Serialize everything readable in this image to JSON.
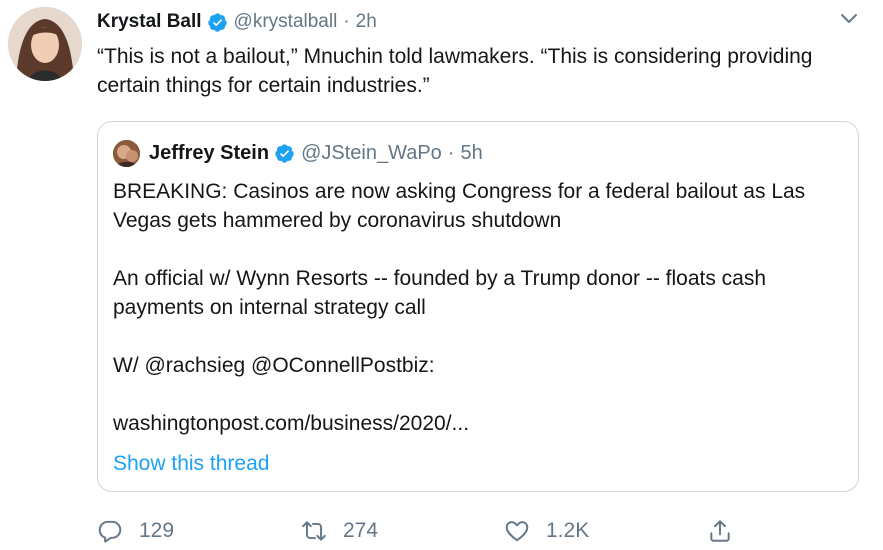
{
  "tweet": {
    "author_name": "Krystal Ball",
    "author_handle": "@krystalball",
    "separator": "·",
    "time": "2h",
    "text": "“This is not a bailout,” Mnuchin told lawmakers. “This is considering providing certain things for certain industries.”",
    "quoted": {
      "author_name": "Jeffrey Stein",
      "author_handle": "@JStein_WaPo",
      "separator": "·",
      "time": "5h",
      "text": "BREAKING: Casinos are now asking Congress for a federal bailout as Las Vegas gets hammered by coronavirus shutdown\n\nAn official w/ Wynn Resorts -- founded by a Trump donor -- floats cash payments on internal strategy call\n\nW/ @rachsieg @OConnellPostbiz:\n\nwashingtonpost.com/business/2020/...",
      "show_thread": "Show this thread"
    },
    "actions": {
      "replies": "129",
      "retweets": "274",
      "likes": "1.2K"
    }
  },
  "colors": {
    "verified": "#1da1f2",
    "link": "#1da1f2",
    "muted": "#657786",
    "border": "#ccd6dd"
  },
  "icons": [
    "verified-badge-icon",
    "chevron-down-icon",
    "reply-icon",
    "retweet-icon",
    "like-icon",
    "share-icon"
  ]
}
